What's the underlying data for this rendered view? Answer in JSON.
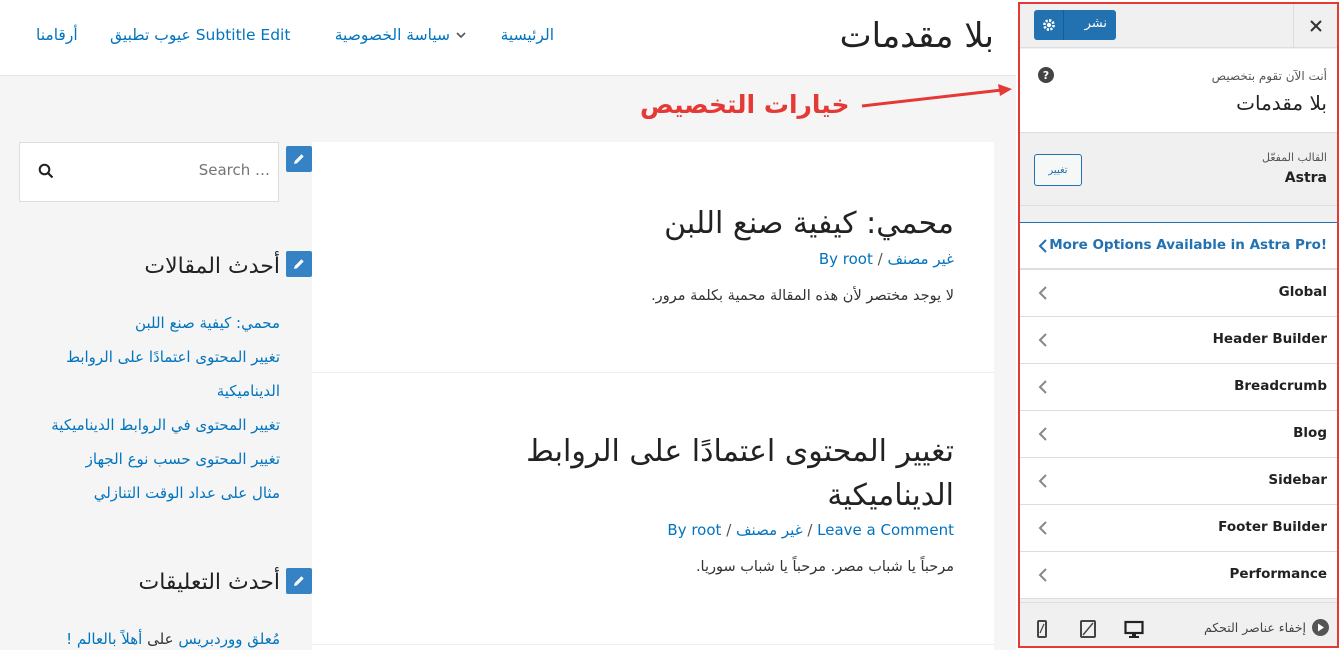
{
  "site": {
    "title": "بلا مقدمات",
    "nav": {
      "home": "الرئيسية",
      "privacy": "سياسة الخصوصية",
      "subtitle_edit": "عيوب تطبيق Subtitle Edit",
      "contact": "أرقامنا"
    }
  },
  "annotation": {
    "text": "خيارات التخصيص",
    "color": "#e53935"
  },
  "posts": [
    {
      "title": "محمي: كيفية صنع اللبن",
      "meta_category": "غير مصنف",
      "meta_author": "By root",
      "excerpt": "لا يوجد مختصر لأن هذه المقالة محمية بكلمة مرور."
    },
    {
      "title": "تغيير المحتوى اعتمادًا على الروابط الديناميكية",
      "meta_comment": "Leave a Comment",
      "meta_category": "غير مصنف",
      "meta_author": "By root",
      "excerpt": "مرحباً يا شباب مصر. مرحباً يا شباب سوريا."
    }
  ],
  "sidebar": {
    "search_placeholder": "Search …",
    "recent_posts_title": "أحدث المقالات",
    "recent_posts": [
      "محمي: كيفية صنع اللبن",
      "تغيير المحتوى اعتمادًا على الروابط الديناميكية",
      "تغيير المحتوى في الروابط الديناميكية",
      "تغيير المحتوى حسب نوع الجهاز",
      "مثال على عداد الوقت التنازلي"
    ],
    "recent_comments_title": "أحدث التعليقات",
    "recent_comment": {
      "author": "مُعلق ووردبريس",
      "on": "على",
      "post": "أهلاً بالعالم !"
    }
  },
  "customizer": {
    "publish_label": "نشر",
    "customizing_label": "أنت الآن تقوم بتخصيص",
    "site_name": "بلا مقدمات",
    "active_theme_label": "القالب المفعّل",
    "theme_name": "Astra",
    "change_label": "تغيير",
    "sections": [
      "More Options Available in Astra Pro!",
      "Global",
      "Header Builder",
      "Breadcrumb",
      "Blog",
      "Sidebar",
      "Footer Builder",
      "Performance"
    ],
    "hide_controls_label": "إخفاء عناصر التحكم",
    "accent_color": "#2271b1"
  }
}
